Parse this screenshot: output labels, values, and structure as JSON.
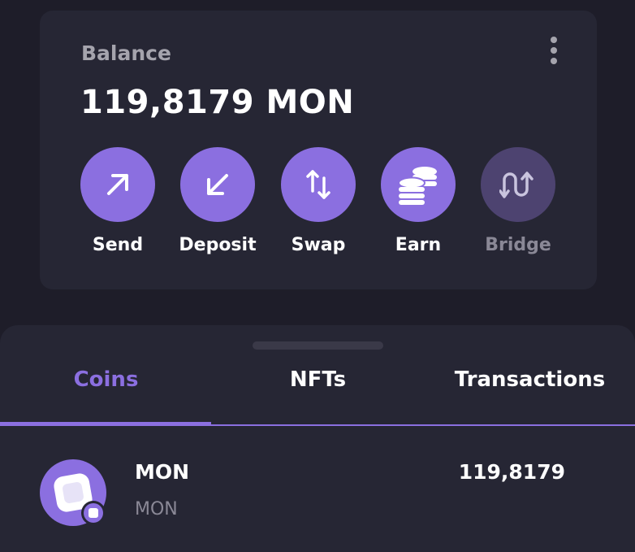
{
  "balance": {
    "label": "Balance",
    "amount": "119,8179 MON"
  },
  "actions": [
    {
      "label": "Send",
      "icon": "arrow-up-right-icon",
      "enabled": true
    },
    {
      "label": "Deposit",
      "icon": "arrow-down-left-icon",
      "enabled": true
    },
    {
      "label": "Swap",
      "icon": "swap-vertical-icon",
      "enabled": true
    },
    {
      "label": "Earn",
      "icon": "coins-stack-icon",
      "enabled": true
    },
    {
      "label": "Bridge",
      "icon": "bridge-icon",
      "enabled": false
    }
  ],
  "tabs": [
    {
      "label": "Coins",
      "active": true
    },
    {
      "label": "NFTs",
      "active": false
    },
    {
      "label": "Transactions",
      "active": false
    }
  ],
  "coins": [
    {
      "name": "MON",
      "symbol": "MON",
      "balance": "119,8179",
      "icon": "monad-logo-icon"
    }
  ],
  "colors": {
    "accent": "#8b6fe0",
    "background": "#1e1d29",
    "card": "#262634",
    "muted_text": "#a5a4ad"
  }
}
